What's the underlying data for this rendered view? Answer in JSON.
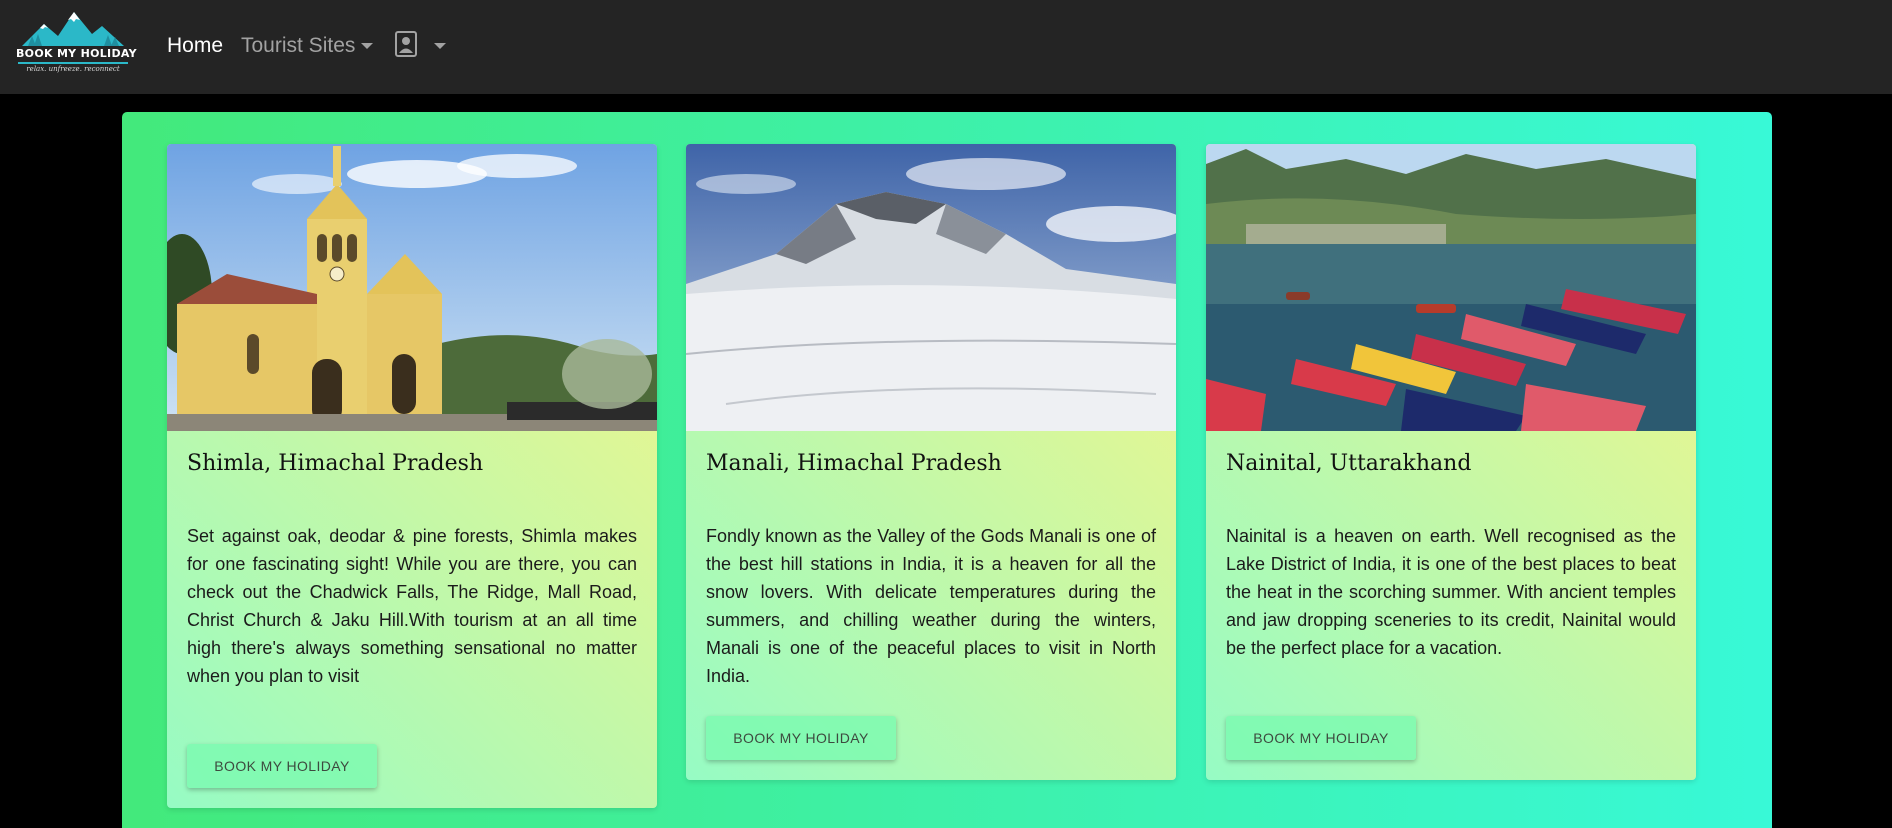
{
  "navbar": {
    "logo": {
      "name": "BOOK MY HOLIDAY",
      "tagline": "relax. unfreeze. reconnect",
      "icon": "mountain-logo"
    },
    "home_label": "Home",
    "tourist_sites_label": "Tourist Sites",
    "profile_icon": "user-portrait-icon"
  },
  "theme": {
    "navbar_bg": "#242424",
    "panel_gradient": [
      "#43e97b",
      "#38f9d7"
    ],
    "card_gradient": [
      "#96fbc4",
      "#f9f586"
    ],
    "button_bg": "#78faaf"
  },
  "cards": [
    {
      "image": "shimla-church-photo",
      "title": "Shimla, Himachal Pradesh",
      "text": "Set against oak, deodar & pine forests, Shimla makes for one fascinating sight! While you are there, you can check out the Chadwick Falls, The Ridge, Mall Road, Christ Church & Jaku Hill.With tourism at an all time high there's always something sensational no matter when you plan to visit",
      "button": "BOOK MY HOLIDAY"
    },
    {
      "image": "manali-snow-mountain-photo",
      "title": "Manali, Himachal Pradesh",
      "text": "Fondly known as the Valley of the Gods Manali is one of the best hill stations in India, it is a heaven for all the snow lovers. With delicate temperatures during the summers, and chilling weather during the winters, Manali is one of the peaceful places to visit in North India.",
      "button": "BOOK MY HOLIDAY"
    },
    {
      "image": "nainital-lake-boats-photo",
      "title": "Nainital, Uttarakhand",
      "text": "Nainital is a heaven on earth. Well recognised as the Lake District of India, it is one of the best places to beat the heat in the scorching summer. With ancient temples and jaw dropping sceneries to its credit, Nainital would be the perfect place for a vacation.",
      "button": "BOOK MY HOLIDAY"
    }
  ]
}
